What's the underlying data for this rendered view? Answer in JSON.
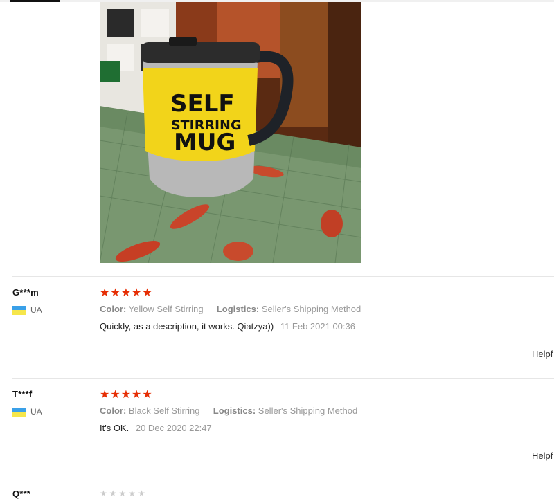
{
  "product_photo": {
    "mug_text": [
      "SELF",
      "STIRRING",
      "MUG"
    ]
  },
  "reviews": [
    {
      "author": "G***m",
      "country": "UA",
      "rating": 5,
      "color_label": "Color:",
      "color_value": "Yellow Self Stirring",
      "logistics_label": "Logistics:",
      "logistics_value": "Seller's Shipping Method",
      "text": "Quickly, as a description, it works. Qiatzya))",
      "date": "11 Feb 2021 00:36",
      "helpful": "Helpf"
    },
    {
      "author": "T***f",
      "country": "UA",
      "rating": 5,
      "color_label": "Color:",
      "color_value": "Black Self Stirring",
      "logistics_label": "Logistics:",
      "logistics_value": "Seller's Shipping Method",
      "text": "It's OK.",
      "date": "20 Dec 2020 22:47",
      "helpful": "Helpf"
    }
  ],
  "next_review_author_partial": "Q***"
}
